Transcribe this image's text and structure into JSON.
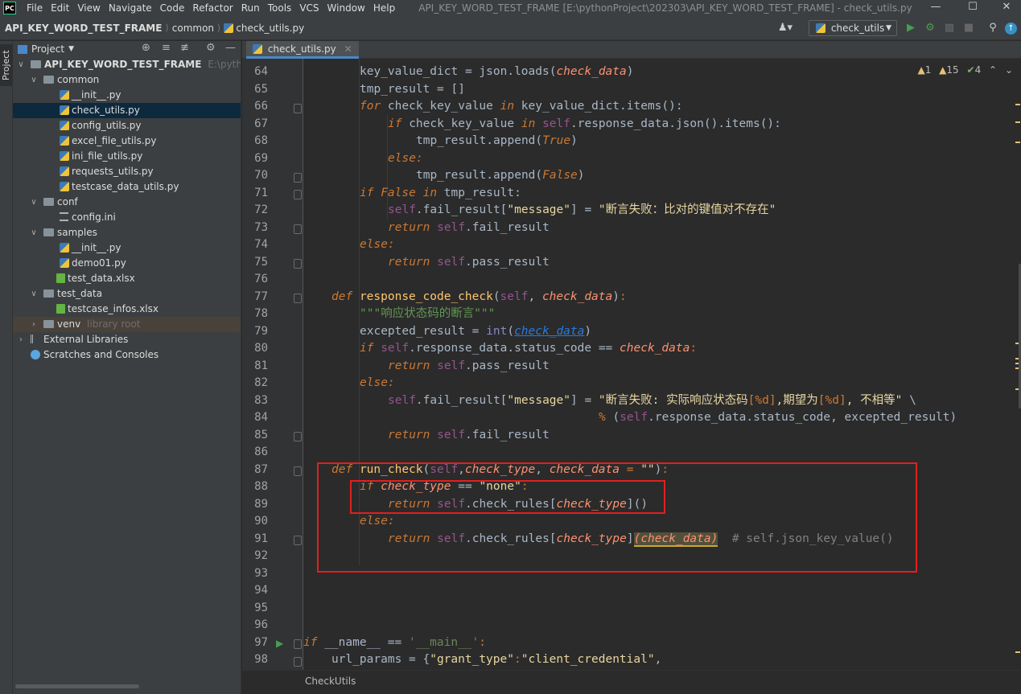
{
  "menu": {
    "items": [
      "File",
      "Edit",
      "View",
      "Navigate",
      "Code",
      "Refactor",
      "Run",
      "Tools",
      "VCS",
      "Window",
      "Help"
    ],
    "window_title": "API_KEY_WORD_TEST_FRAME [E:\\pythonProject\\202303\\API_KEY_WORD_TEST_FRAME] - check_utils.py"
  },
  "navbar": {
    "project": "API_KEY_WORD_TEST_FRAME",
    "folder": "common",
    "file": "check_utils.py",
    "run_config": "check_utils"
  },
  "tool_strip": {
    "project_tab": "Project"
  },
  "project_panel": {
    "title": "Project",
    "root_name": "API_KEY_WORD_TEST_FRAME",
    "root_path": "E:\\pythonProj",
    "items": [
      {
        "label": "common"
      },
      {
        "label": "__init__.py"
      },
      {
        "label": "check_utils.py"
      },
      {
        "label": "config_utils.py"
      },
      {
        "label": "excel_file_utils.py"
      },
      {
        "label": "ini_file_utils.py"
      },
      {
        "label": "requests_utils.py"
      },
      {
        "label": "testcase_data_utils.py"
      },
      {
        "label": "conf"
      },
      {
        "label": "config.ini"
      },
      {
        "label": "samples"
      },
      {
        "label": "__init__.py"
      },
      {
        "label": "demo01.py"
      },
      {
        "label": "test_data.xlsx"
      },
      {
        "label": "test_data"
      },
      {
        "label": "testcase_infos.xlsx"
      },
      {
        "label": "venv"
      },
      {
        "label": "External Libraries"
      },
      {
        "label": "Scratches and Consoles"
      }
    ],
    "venv_note": "library root"
  },
  "editor": {
    "tab_label": "check_utils.py",
    "inspections": {
      "warnings": "1",
      "weak_warnings": "15",
      "typos": "4"
    },
    "line_numbers": [
      "64",
      "65",
      "66",
      "67",
      "68",
      "69",
      "70",
      "71",
      "72",
      "73",
      "74",
      "75",
      "76",
      "77",
      "78",
      "79",
      "80",
      "81",
      "82",
      "83",
      "84",
      "85",
      "86",
      "87",
      "88",
      "89",
      "90",
      "91",
      "92",
      "93",
      "94",
      "95",
      "96",
      "97",
      "98"
    ],
    "footer_breadcrumb": "CheckUtils",
    "code": {
      "l64_a": "key_value_dict = json.",
      "l64_b": "loads",
      "l64_c": "(",
      "l64_d": "check_data",
      "l64_e": ")",
      "l65": "tmp_result = []",
      "l66_kw": "for",
      "l66_a": " check_key_value ",
      "l66_in": "in",
      "l66_b": " key_value_dict.items():",
      "l67_kw": "if",
      "l67_a": " check_key_value ",
      "l67_in": "in",
      "l67_self": "self",
      "l67_b": ".response_data.json().items():",
      "l68_a": "tmp_result.append(",
      "l68_b": "True",
      "l68_c": ")",
      "l69": "else:",
      "l70_a": "tmp_result.append(",
      "l70_b": "False",
      "l70_c": ")",
      "l71_kw": "if",
      "l71_f": "False",
      "l71_in": "in",
      "l71_a": " tmp_result:",
      "l72_self": "self",
      "l72_a": ".fail_result[",
      "l72_k": "\"message\"",
      "l72_b": "] = ",
      "l72_s": "\"断言失败：比对的键值对不存在\"",
      "l73_kw": "return",
      "l73_self": "self",
      "l73_a": ".fail_result",
      "l74": "else:",
      "l75_kw": "return",
      "l75_self": "self",
      "l75_a": ".pass_result",
      "l77_kw": "def",
      "l77_fn": "response_code_check",
      "l77_self": "self",
      "l77_p": "check_data",
      "l78": "\"\"\"响应状态码的断言\"\"\"",
      "l79_a": "excepted_result = ",
      "l79_bi": "int",
      "l79_p": "check_data",
      "l80_kw": "if",
      "l80_self": "self",
      "l80_a": ".response_data.status_code == ",
      "l80_p": "check_data",
      "l81_kw": "return",
      "l81_self": "self",
      "l81_a": ".pass_result",
      "l82": "else:",
      "l83_self": "self",
      "l83_a": ".fail_result[",
      "l83_k": "\"message\"",
      "l83_b": "] = ",
      "l83_s": "\"断言失败: 实际响应状态码",
      "l83_f1": "[%d]",
      "l83_s2": ",期望为",
      "l83_f2": "[%d]",
      "l83_s3": ", 不相等\"",
      "l83_c": " \\",
      "l84_op": "% ",
      "l84_a": "(",
      "l84_self": "self",
      "l84_b": ".response_data.status_code, excepted_result)",
      "l85_kw": "return",
      "l85_self": "self",
      "l85_a": ".fail_result",
      "l87_kw": "def",
      "l87_fn": "run_check",
      "l87_self": "self",
      "l87_p1": "check_type",
      "l87_p2": "check_data",
      "l87_s": "\"\"",
      "l88_kw": "if",
      "l88_p": "check_type",
      "l88_s": "\"none\"",
      "l89_kw": "return",
      "l89_self": "self",
      "l89_a": ".check_rules[",
      "l89_p": "check_type",
      "l89_b": "]()",
      "l90": "else:",
      "l91_kw": "return",
      "l91_self": "self",
      "l91_a": ".check_rules[",
      "l91_p": "check_type",
      "l91_b": "]",
      "l91_hl": "(check_data)",
      "l91_c": "# self.json_key_value()",
      "l97_kw": "if",
      "l97_a": "__name__",
      "l97_s": "'__main__'",
      "l98_a": "url_params = {",
      "l98_k": "\"grant_type\"",
      "l98_s": "\"client_credential\""
    }
  }
}
